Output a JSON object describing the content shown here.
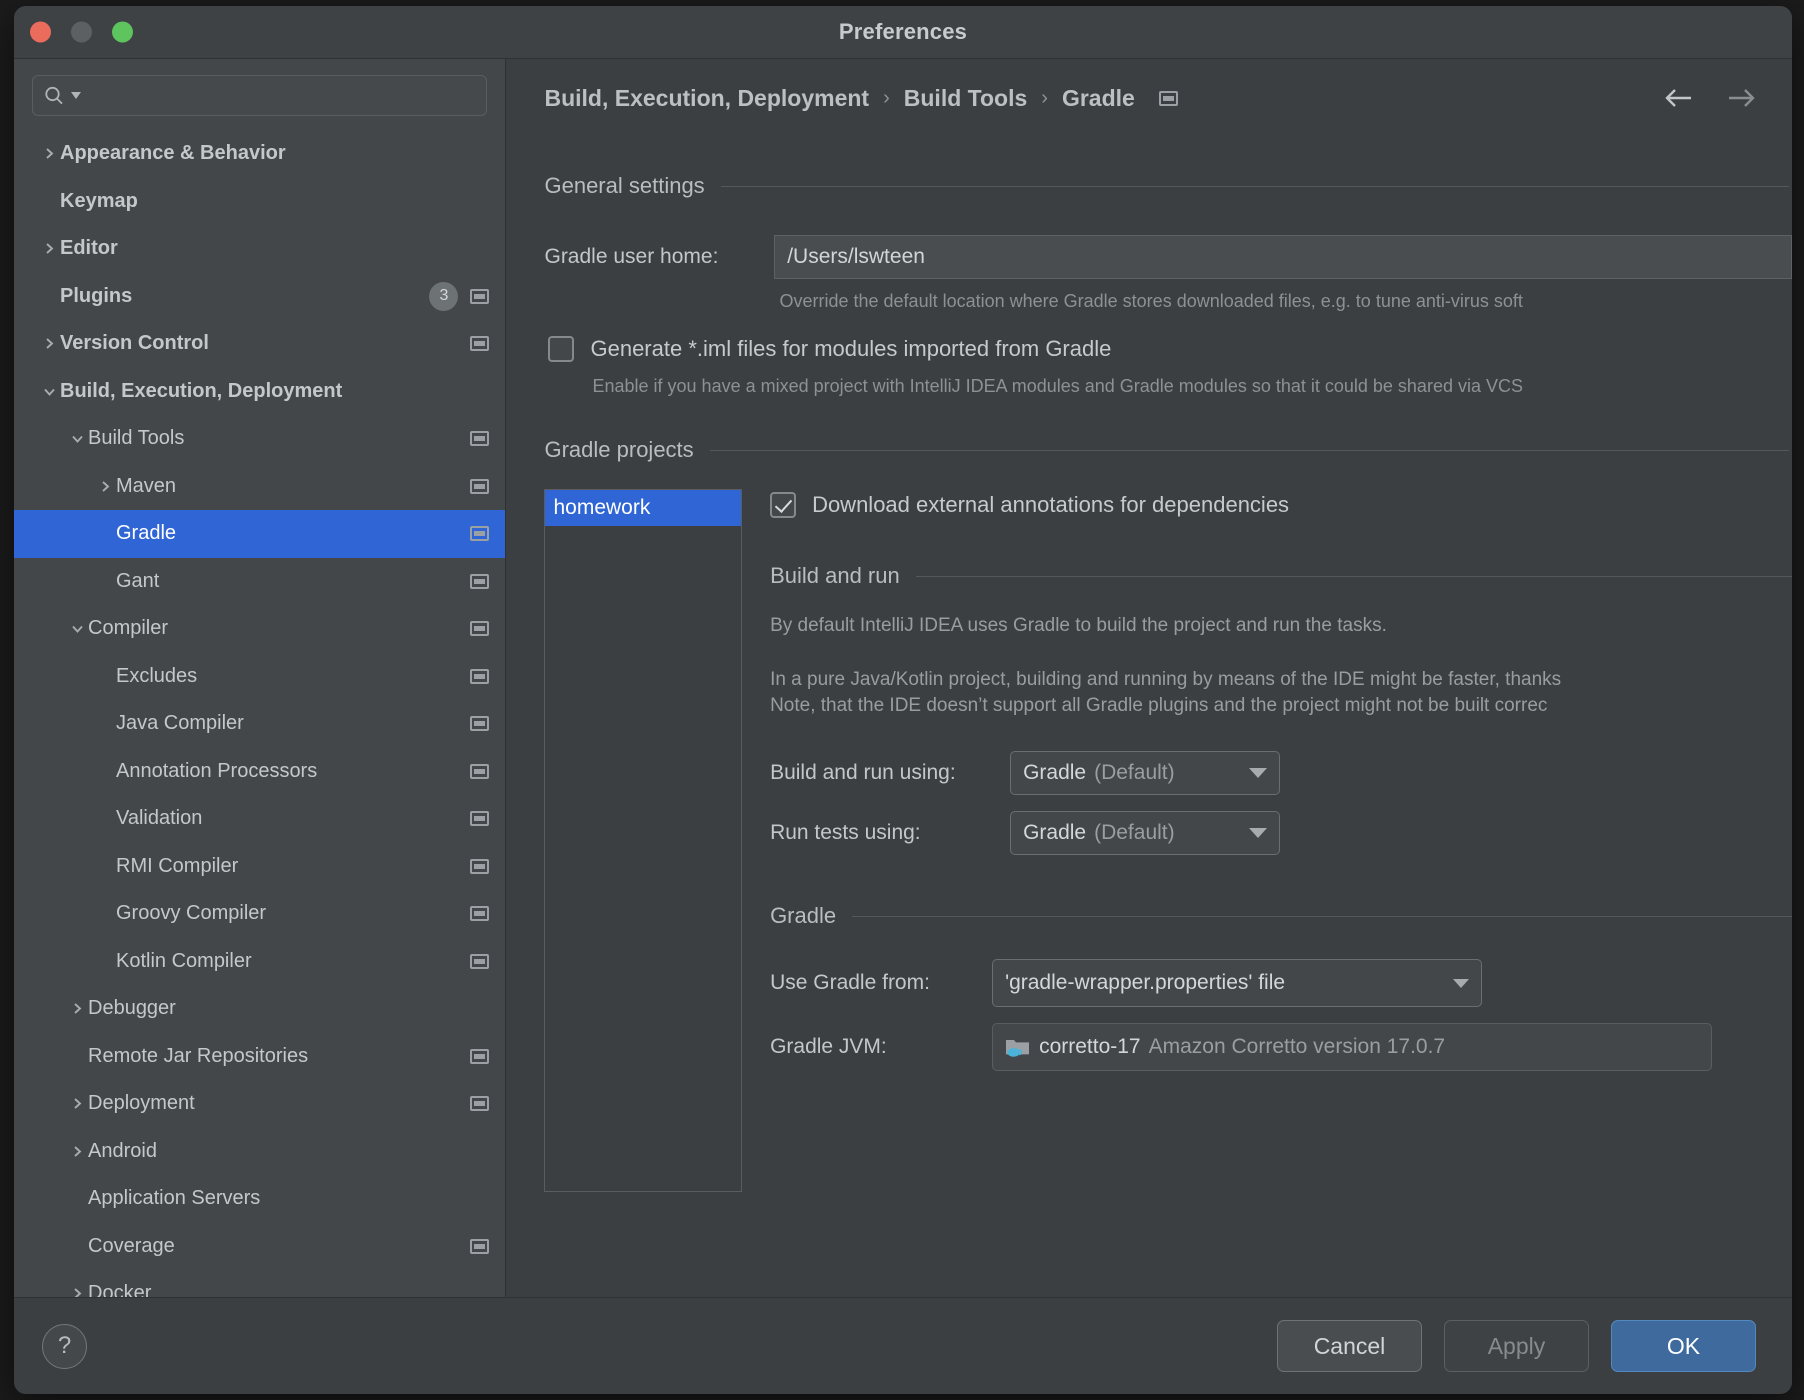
{
  "window": {
    "title": "Preferences",
    "traffic_lights": [
      "close",
      "minimize",
      "zoom"
    ]
  },
  "search": {
    "placeholder": "",
    "value": "",
    "icon": "search-icon"
  },
  "sidebar": {
    "items": [
      {
        "label": "Appearance & Behavior",
        "indent": 0,
        "arrow": "right",
        "bold": true,
        "badge": null,
        "scope": false,
        "selected": false
      },
      {
        "label": "Keymap",
        "indent": 0,
        "arrow": "none",
        "bold": true,
        "badge": null,
        "scope": false,
        "selected": false
      },
      {
        "label": "Editor",
        "indent": 0,
        "arrow": "right",
        "bold": true,
        "badge": null,
        "scope": false,
        "selected": false
      },
      {
        "label": "Plugins",
        "indent": 0,
        "arrow": "none",
        "bold": true,
        "badge": "3",
        "scope": true,
        "selected": false
      },
      {
        "label": "Version Control",
        "indent": 0,
        "arrow": "right",
        "bold": true,
        "badge": null,
        "scope": true,
        "selected": false
      },
      {
        "label": "Build, Execution, Deployment",
        "indent": 0,
        "arrow": "down",
        "bold": true,
        "badge": null,
        "scope": false,
        "selected": false
      },
      {
        "label": "Build Tools",
        "indent": 1,
        "arrow": "down",
        "bold": false,
        "badge": null,
        "scope": true,
        "selected": false
      },
      {
        "label": "Maven",
        "indent": 2,
        "arrow": "right",
        "bold": false,
        "badge": null,
        "scope": true,
        "selected": false
      },
      {
        "label": "Gradle",
        "indent": 2,
        "arrow": "none",
        "bold": false,
        "badge": null,
        "scope": true,
        "selected": true
      },
      {
        "label": "Gant",
        "indent": 2,
        "arrow": "none",
        "bold": false,
        "badge": null,
        "scope": true,
        "selected": false
      },
      {
        "label": "Compiler",
        "indent": 1,
        "arrow": "down",
        "bold": false,
        "badge": null,
        "scope": true,
        "selected": false
      },
      {
        "label": "Excludes",
        "indent": 2,
        "arrow": "none",
        "bold": false,
        "badge": null,
        "scope": true,
        "selected": false
      },
      {
        "label": "Java Compiler",
        "indent": 2,
        "arrow": "none",
        "bold": false,
        "badge": null,
        "scope": true,
        "selected": false
      },
      {
        "label": "Annotation Processors",
        "indent": 2,
        "arrow": "none",
        "bold": false,
        "badge": null,
        "scope": true,
        "selected": false
      },
      {
        "label": "Validation",
        "indent": 2,
        "arrow": "none",
        "bold": false,
        "badge": null,
        "scope": true,
        "selected": false
      },
      {
        "label": "RMI Compiler",
        "indent": 2,
        "arrow": "none",
        "bold": false,
        "badge": null,
        "scope": true,
        "selected": false
      },
      {
        "label": "Groovy Compiler",
        "indent": 2,
        "arrow": "none",
        "bold": false,
        "badge": null,
        "scope": true,
        "selected": false
      },
      {
        "label": "Kotlin Compiler",
        "indent": 2,
        "arrow": "none",
        "bold": false,
        "badge": null,
        "scope": true,
        "selected": false
      },
      {
        "label": "Debugger",
        "indent": 1,
        "arrow": "right",
        "bold": false,
        "badge": null,
        "scope": false,
        "selected": false
      },
      {
        "label": "Remote Jar Repositories",
        "indent": 1,
        "arrow": "none",
        "bold": false,
        "badge": null,
        "scope": true,
        "selected": false
      },
      {
        "label": "Deployment",
        "indent": 1,
        "arrow": "right",
        "bold": false,
        "badge": null,
        "scope": true,
        "selected": false
      },
      {
        "label": "Android",
        "indent": 1,
        "arrow": "right",
        "bold": false,
        "badge": null,
        "scope": false,
        "selected": false
      },
      {
        "label": "Application Servers",
        "indent": 1,
        "arrow": "none",
        "bold": false,
        "badge": null,
        "scope": false,
        "selected": false
      },
      {
        "label": "Coverage",
        "indent": 1,
        "arrow": "none",
        "bold": false,
        "badge": null,
        "scope": true,
        "selected": false
      },
      {
        "label": "Docker",
        "indent": 1,
        "arrow": "right",
        "bold": false,
        "badge": null,
        "scope": false,
        "selected": false
      }
    ]
  },
  "breadcrumb": {
    "crumbs": [
      "Build, Execution, Deployment",
      "Build Tools",
      "Gradle"
    ],
    "separator": "›",
    "scope_icon": "project-scope-icon",
    "back_icon": "arrow-left-icon",
    "forward_icon": "arrow-right-icon"
  },
  "general_settings": {
    "title": "General settings",
    "gradle_user_home_label": "Gradle user home:",
    "gradle_user_home_value": "/Users/lswteen",
    "gradle_user_home_placeholder": "",
    "gradle_user_home_hint": "Override the default location where Gradle stores downloaded files, e.g. to tune anti-virus soft",
    "generate_iml_label": "Generate *.iml files for modules imported from Gradle",
    "generate_iml_checked": false,
    "generate_iml_hint": "Enable if you have a mixed project with IntelliJ IDEA modules and Gradle modules so that it could be shared via VCS"
  },
  "gradle_projects": {
    "title": "Gradle projects",
    "projects": [
      {
        "name": "homework",
        "selected": true
      }
    ],
    "download_annotations_label": "Download external annotations for dependencies",
    "download_annotations_checked": true
  },
  "build_and_run": {
    "title": "Build and run",
    "paragraph_1": "By default IntelliJ IDEA uses Gradle to build the project and run the tasks.",
    "paragraph_2_line_1": "In a pure Java/Kotlin project, building and running by means of the IDE might be faster, thanks",
    "paragraph_2_line_2": "Note, that the IDE doesn’t support all Gradle plugins and the project might not be built correc",
    "build_run_using_label": "Build and run using:",
    "build_run_using_value": "Gradle",
    "build_run_using_suffix": "(Default)",
    "run_tests_using_label": "Run tests using:",
    "run_tests_using_value": "Gradle",
    "run_tests_using_suffix": "(Default)"
  },
  "gradle_section": {
    "title": "Gradle",
    "use_gradle_from_label": "Use Gradle from:",
    "use_gradle_from_value": "'gradle-wrapper.properties' file",
    "gradle_jvm_label": "Gradle JVM:",
    "gradle_jvm_value": "corretto-17",
    "gradle_jvm_suffix": "Amazon Corretto version 17.0.7",
    "gradle_jvm_icon": "jdk-folder-icon"
  },
  "footer": {
    "help_label": "?",
    "cancel_label": "Cancel",
    "apply_label": "Apply",
    "ok_label": "OK"
  },
  "colors": {
    "accent": "#2f65d4",
    "ok_button": "#3e6a9e",
    "window_bg": "#3c3f41",
    "sidebar_bg": "#434749",
    "jdk_badge": "#4bb3d8"
  }
}
